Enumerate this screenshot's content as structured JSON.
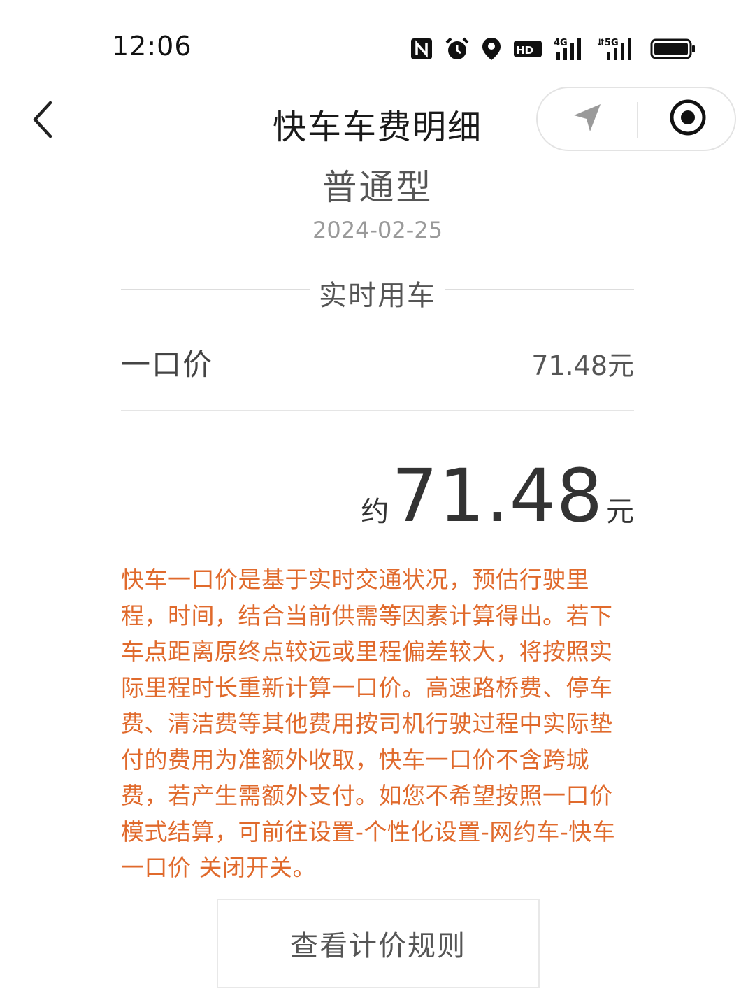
{
  "status_bar": {
    "time": "12:06",
    "icons": [
      "nfc-icon",
      "alarm-icon",
      "location-icon",
      "hd-icon",
      "signal-4g-icon",
      "signal-5g-icon",
      "battery-icon"
    ]
  },
  "nav": {
    "title": "快车车费明细",
    "back_icon": "chevron-left-icon",
    "capsule_left_icon": "navigation-arrow-icon",
    "capsule_right_icon": "record-target-icon"
  },
  "trip": {
    "car_type": "普通型",
    "date": "2024-02-25",
    "section_label": "实时用车"
  },
  "fee_items": [
    {
      "label": "一口价",
      "value": "71.48元"
    }
  ],
  "total": {
    "prefix": "约",
    "amount": "71.48",
    "unit": "元"
  },
  "notice": "快车一口价是基于实时交通状况，预估行驶里程，时间，结合当前供需等因素计算得出。若下车点距离原终点较远或里程偏差较大，将按照实际里程时长重新计算一口价。高速路桥费、停车费、清洁费等其他费用按司机行驶过程中实际垫付的费用为准额外收取，快车一口价不含跨城费，若产生需额外支付。如您不希望按照一口价模式结算，可前往设置-个性化设置-网约车-快车一口价 关闭开关。",
  "rules_button_label": "查看计价规则",
  "colors": {
    "notice": "#e06a2c",
    "text": "#333333",
    "muted": "#9a9a9a"
  }
}
